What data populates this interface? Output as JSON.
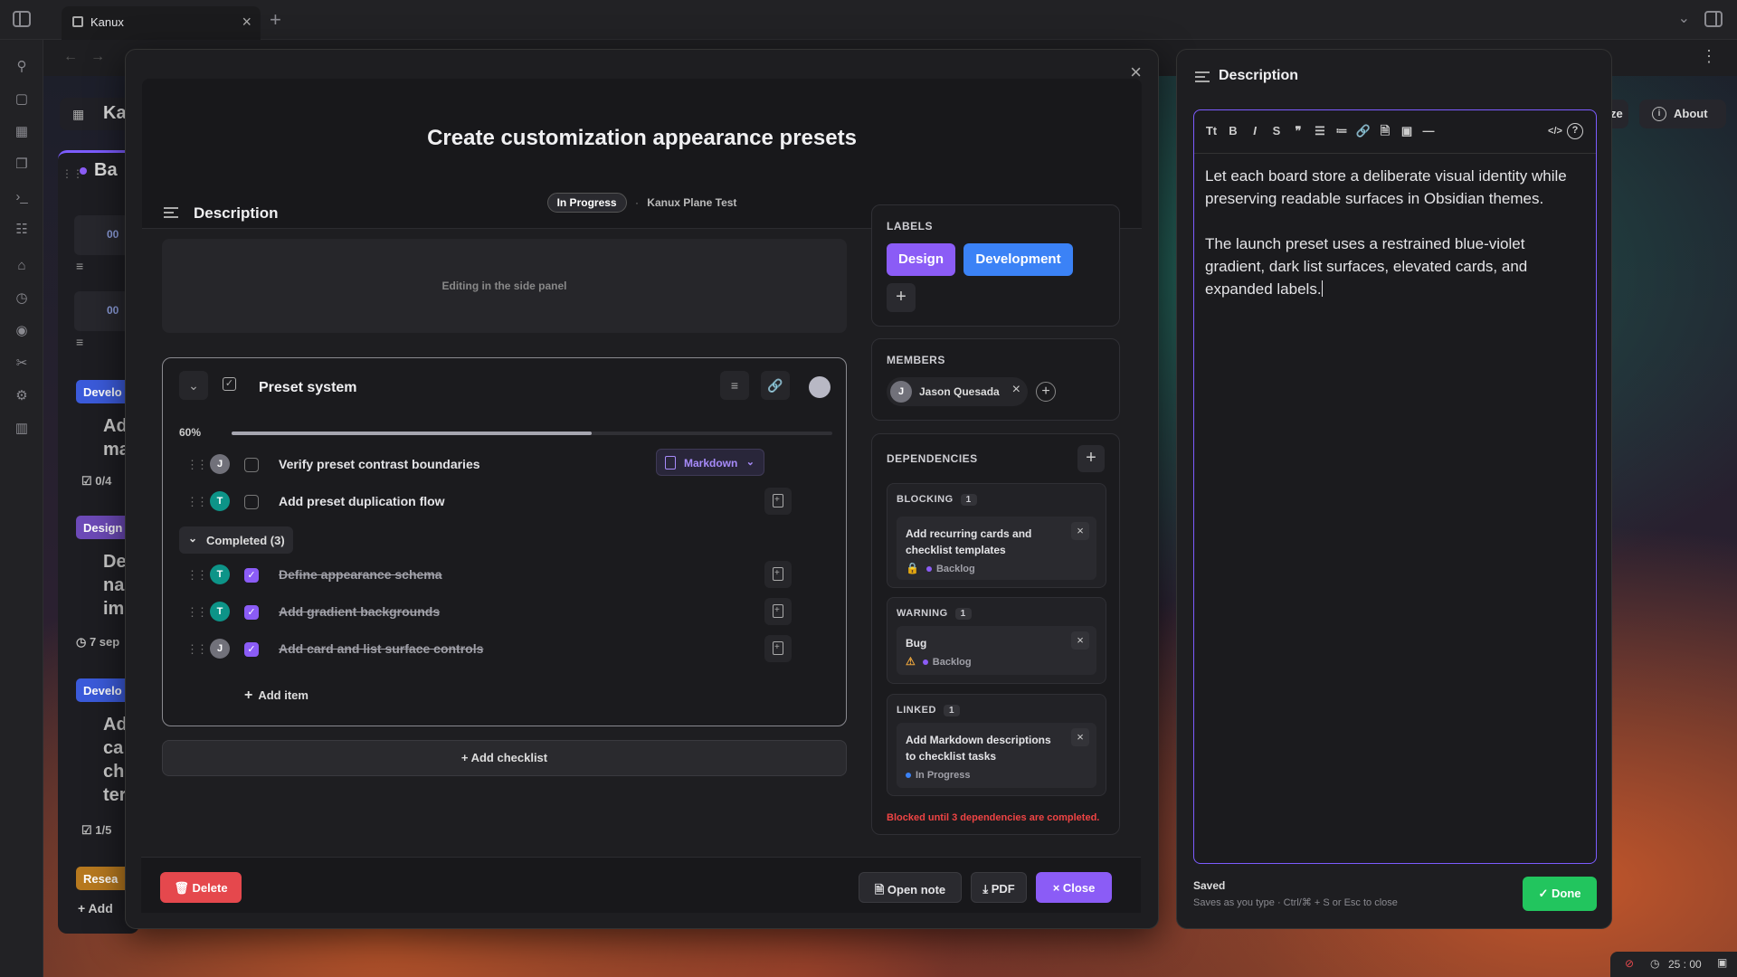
{
  "window": {
    "tab_title": "Kanux",
    "tab_close": "×",
    "new_tab": "+",
    "chevron": "⌄",
    "more": "⋮"
  },
  "background": {
    "header_partial": "Ka",
    "column_partial": "Ba",
    "about_label": "About",
    "about_icon": "i",
    "zen_partial": "ze",
    "chips": [
      {
        "label": "Develo",
        "color": "#3b5bdb"
      },
      {
        "label": "Design",
        "color": "#6d4ab8"
      },
      {
        "label": "Develo",
        "color": "#3b5bdb"
      },
      {
        "label": "Resea",
        "color": "#b7791f"
      }
    ],
    "texts": [
      "Ad",
      "ma",
      "0/4",
      "De",
      "na",
      "im",
      "7 sep",
      "Ad",
      "ca",
      "ch",
      "ter",
      "1/5",
      "Add"
    ],
    "code_partials": [
      "00",
      "00"
    ]
  },
  "modal": {
    "close": "×",
    "title": "Create customization appearance presets",
    "status": "In Progress",
    "separator": "·",
    "board": "Kanux Plane Test",
    "description_heading": "Description",
    "description_placeholder": "Editing in the side panel",
    "checklist": {
      "title": "Preset system",
      "progress_label": "60%",
      "progress": 0.6,
      "collapse_icon": "⌄",
      "menu_icon": "≡",
      "link_icon": "🔗",
      "open_items": [
        {
          "avatar": "J",
          "avatar_color": "#71717a",
          "text": "Verify preset contrast boundaries",
          "format": "Markdown"
        },
        {
          "avatar": "T",
          "avatar_color": "#0d9488",
          "text": "Add preset duplication flow"
        }
      ],
      "completed_label": "Completed (3)",
      "completed_items": [
        {
          "avatar": "T",
          "avatar_color": "#0d9488",
          "text": "Define appearance schema"
        },
        {
          "avatar": "T",
          "avatar_color": "#0d9488",
          "text": "Add gradient backgrounds"
        },
        {
          "avatar": "J",
          "avatar_color": "#71717a",
          "text": "Add card and list surface controls"
        }
      ],
      "check_mark": "✓",
      "add_item": "Add item",
      "plus": "+"
    },
    "add_checklist": "Add checklist",
    "labels": {
      "heading": "LABELS",
      "items": [
        {
          "name": "Design",
          "color": "#8b5cf6"
        },
        {
          "name": "Development",
          "color": "#3b82f6"
        }
      ],
      "add": "+"
    },
    "members": {
      "heading": "MEMBERS",
      "items": [
        {
          "initial": "J",
          "name": "Jason Quesada"
        }
      ],
      "remove": "×",
      "add": "+"
    },
    "dependencies": {
      "heading": "DEPENDENCIES",
      "add": "+",
      "groups": [
        {
          "type": "BLOCKING",
          "count": "1",
          "item": "Add recurring cards and checklist templates",
          "status": "Backlog",
          "status_color": "#8b5cf6",
          "symbol": "🔒"
        },
        {
          "type": "WARNING",
          "count": "1",
          "item": "Bug",
          "status": "Backlog",
          "status_color": "#8b5cf6",
          "symbol": "⚠"
        },
        {
          "type": "LINKED",
          "count": "1",
          "item": "Add Markdown descriptions to checklist tasks",
          "status": "In Progress",
          "status_color": "#3b82f6",
          "symbol": ""
        }
      ],
      "remove": "×",
      "warning": "Blocked until 3 dependencies are completed."
    },
    "footer": {
      "delete": "Delete",
      "open_note": "Open note",
      "pdf": "PDF",
      "close": "Close",
      "delete_icon": "🗑",
      "note_icon": "🗎",
      "pdf_icon": "⤓",
      "close_icon": "×"
    },
    "colors": {
      "accent": "#8b5cf6",
      "danger": "#ef4444",
      "success": "#22c55e"
    }
  },
  "description_panel": {
    "title": "Description",
    "toolbar": [
      "Tt",
      "B",
      "I",
      "S",
      "❞",
      "☰",
      "≔",
      "🔗",
      "🗎",
      "▣",
      "—",
      "</>",
      "?"
    ],
    "paragraphs": [
      "Let each board store a deliberate visual identity while preserving readable surfaces in Obsidian themes.",
      "The launch preset uses a restrained blue-violet gradient, dark list surfaces, elevated cards, and expanded labels."
    ],
    "saved": "Saved",
    "hint": "Saves as you type · Ctrl/⌘ + S or Esc to close",
    "done": "Done",
    "done_icon": "✓"
  },
  "statusbar": {
    "timer": "25 : 00"
  }
}
